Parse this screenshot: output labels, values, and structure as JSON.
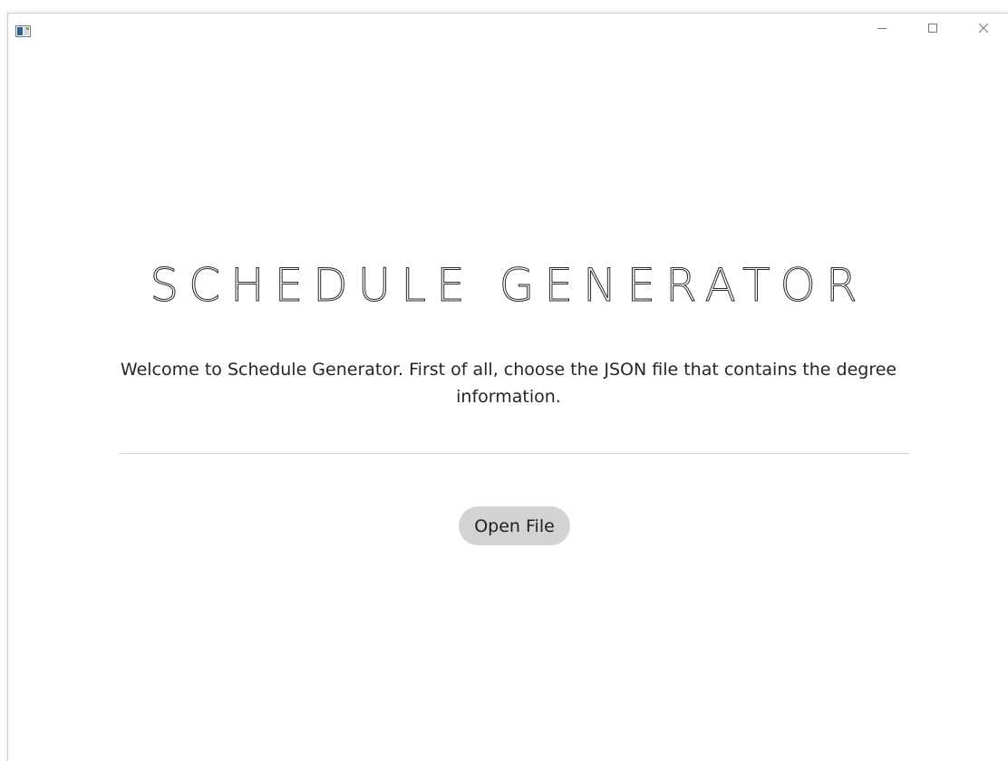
{
  "window": {
    "controls": {
      "minimize_icon": "minimize-icon",
      "maximize_icon": "maximize-icon",
      "close_icon": "close-icon"
    }
  },
  "main": {
    "title": "SCHEDULE GENERATOR",
    "welcome_text": "Welcome to Schedule Generator. First of all, choose the JSON file that contains the degree information.",
    "open_button_label": "Open File"
  },
  "colors": {
    "button_bg": "#d3d3d3",
    "divider": "#d2d2d2",
    "text": "#262626"
  }
}
